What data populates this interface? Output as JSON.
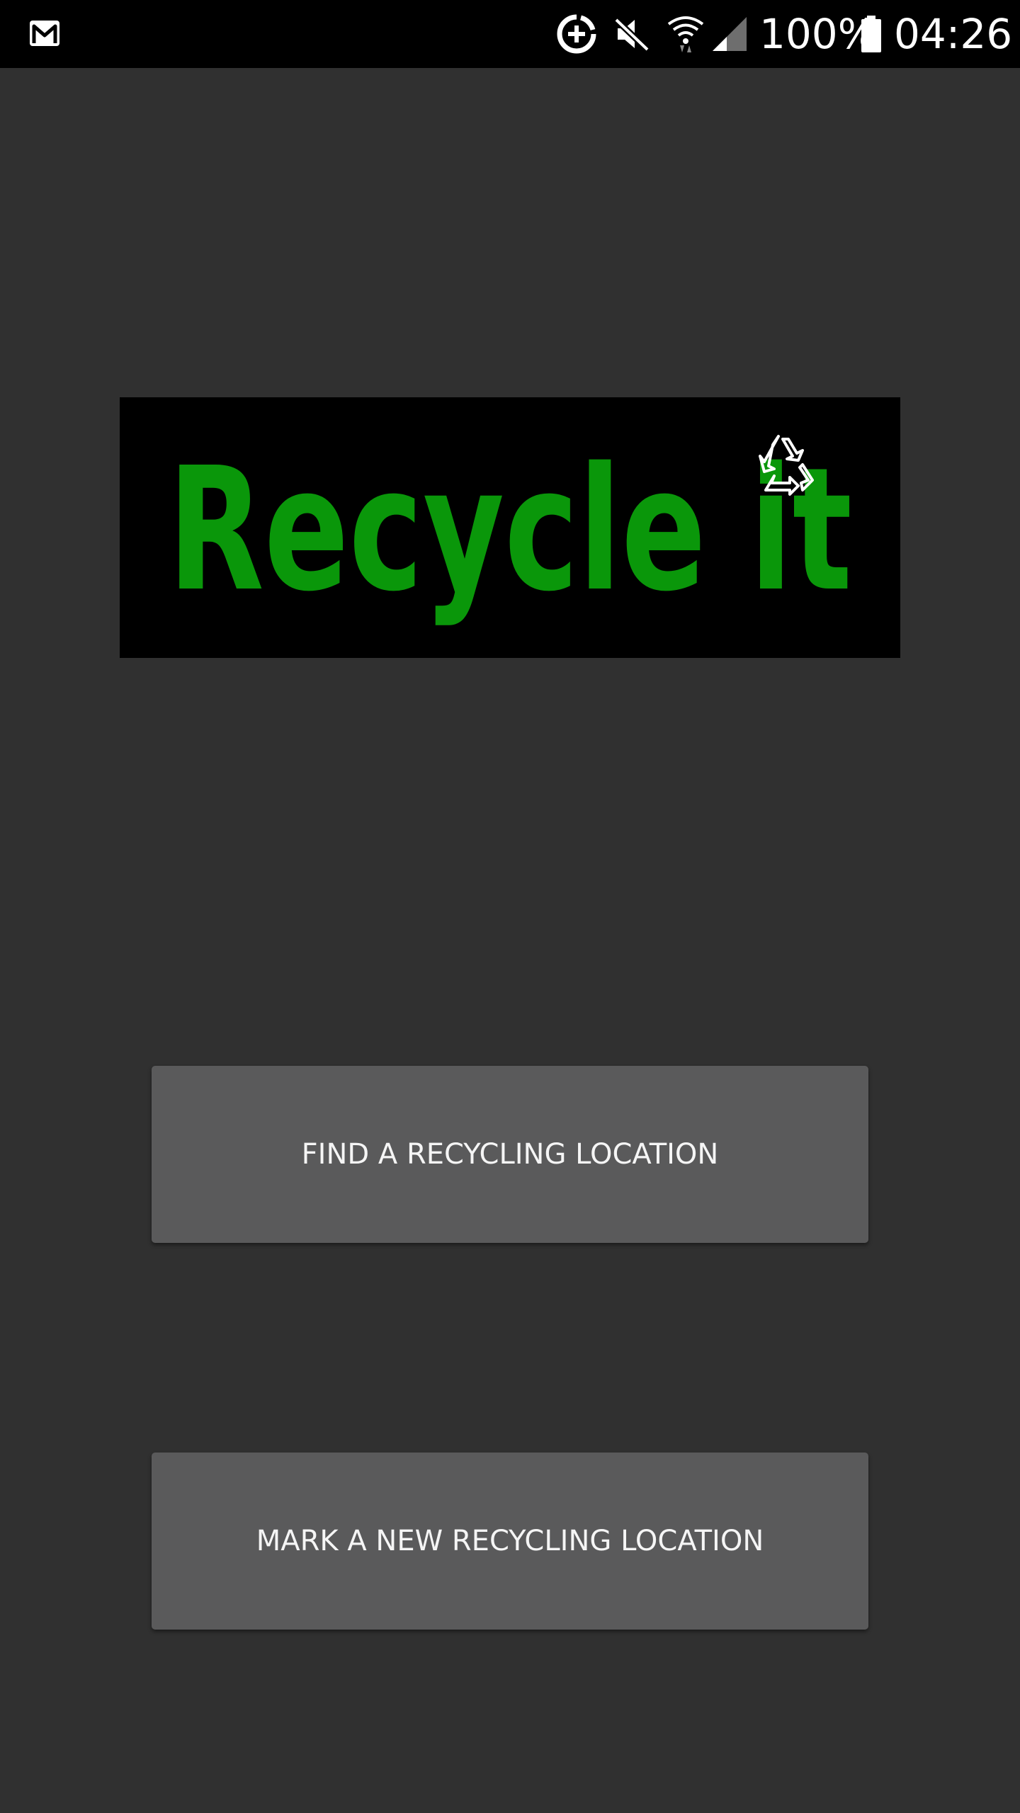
{
  "status_bar": {
    "battery_percent": "100%",
    "time": "04:26",
    "icons": [
      "gmail-icon",
      "data-saver-icon",
      "mute-icon",
      "wifi-icon",
      "cell-signal-icon",
      "battery-icon"
    ]
  },
  "logo": {
    "text": "Recycle it",
    "icon": "recycle-icon",
    "text_color": "#0a970a",
    "background": "#000000"
  },
  "buttons": {
    "find_label": "FIND A RECYCLING LOCATION",
    "mark_label": "MARK A NEW RECYCLING LOCATION"
  },
  "colors": {
    "background": "#303030",
    "button": "#5a5a5b",
    "status_bar": "#000000"
  }
}
